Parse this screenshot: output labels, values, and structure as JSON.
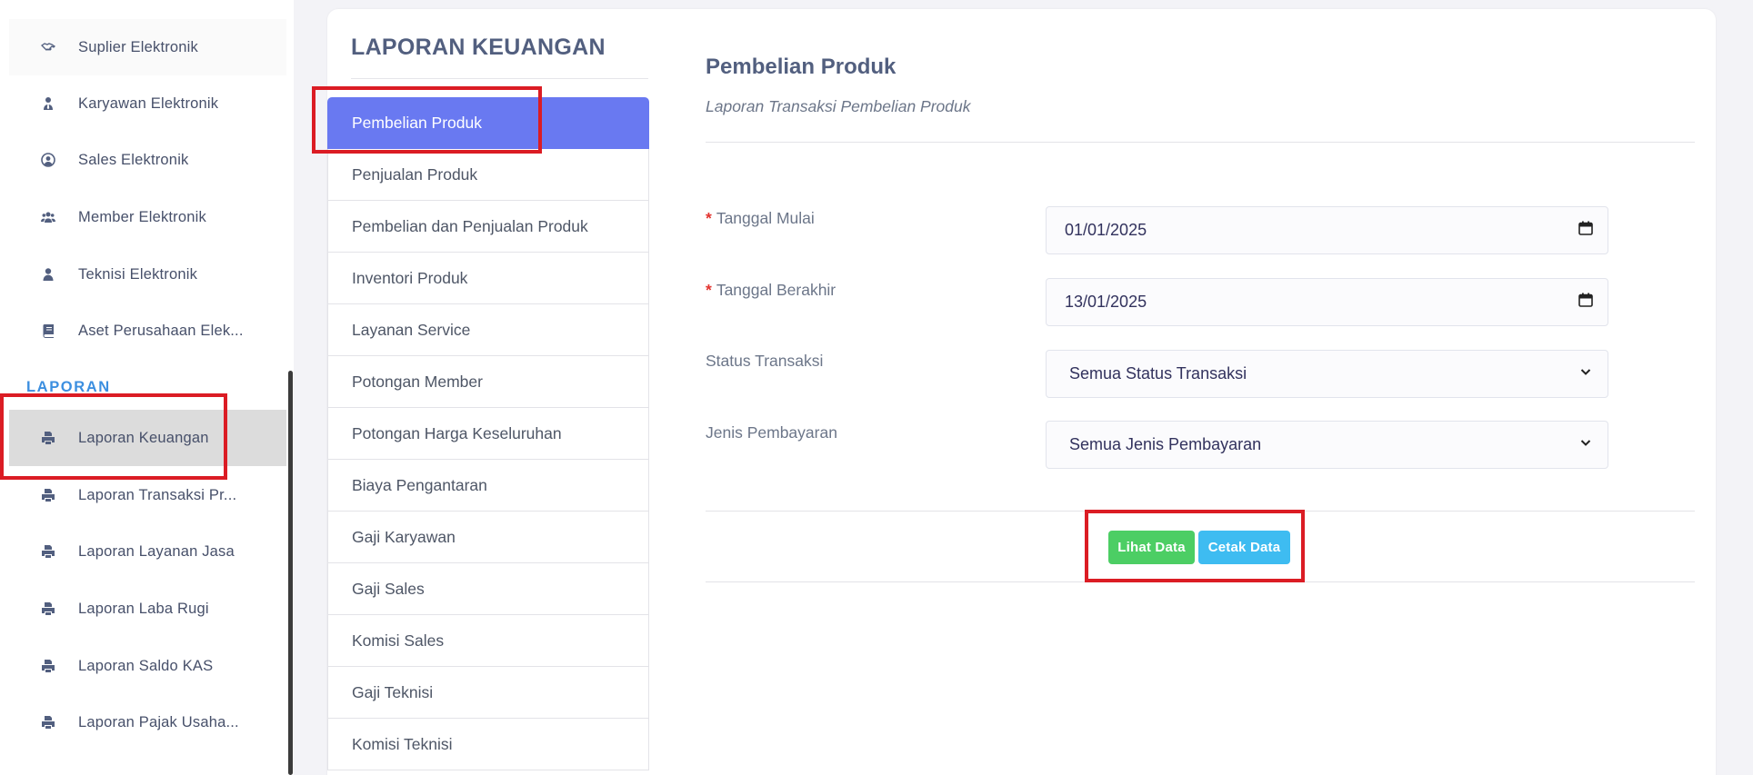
{
  "sidebar": {
    "items_top": [
      {
        "label": "Suplier Elektronik",
        "icon": "handshake-icon"
      },
      {
        "label": "Karyawan Elektronik",
        "icon": "user-tie-icon"
      },
      {
        "label": "Sales Elektronik",
        "icon": "user-circle-icon"
      },
      {
        "label": "Member Elektronik",
        "icon": "users-icon"
      },
      {
        "label": "Teknisi Elektronik",
        "icon": "user-icon"
      },
      {
        "label": "Aset Perusahaan Elek...",
        "icon": "book-icon"
      }
    ],
    "section_heading": "LAPORAN",
    "items_laporan": [
      {
        "label": "Laporan Keuangan",
        "icon": "print-icon",
        "active": true
      },
      {
        "label": "Laporan Transaksi Pr...",
        "icon": "print-icon"
      },
      {
        "label": "Laporan Layanan Jasa",
        "icon": "print-icon"
      },
      {
        "label": "Laporan Laba Rugi",
        "icon": "print-icon"
      },
      {
        "label": "Laporan Saldo KAS",
        "icon": "print-icon"
      },
      {
        "label": "Laporan Pajak Usaha...",
        "icon": "print-icon"
      }
    ]
  },
  "report_menu": {
    "title": "LAPORAN KEUANGAN",
    "items": [
      "Pembelian Produk",
      "Penjualan Produk",
      "Pembelian dan Penjualan Produk",
      "Inventori Produk",
      "Layanan Service",
      "Potongan Member",
      "Potongan Harga Keseluruhan",
      "Biaya Pengantaran",
      "Gaji Karyawan",
      "Gaji Sales",
      "Komisi Sales",
      "Gaji Teknisi",
      "Komisi Teknisi"
    ],
    "active_index": 0
  },
  "form": {
    "title": "Pembelian Produk",
    "subtitle": "Laporan Transaksi Pembelian Produk",
    "required_mark": "*",
    "fields": {
      "start_date": {
        "label": "Tanggal Mulai",
        "value": "01/01/2025"
      },
      "end_date": {
        "label": "Tanggal Berakhir",
        "value": "13/01/2025"
      },
      "status": {
        "label": "Status Transaksi",
        "value": "Semua Status Transaksi"
      },
      "payment": {
        "label": "Jenis Pembayaran",
        "value": "Semua Jenis Pembayaran"
      }
    },
    "buttons": {
      "view_label": "Lihat Data",
      "print_label": "Cetak Data"
    }
  },
  "colors": {
    "accent": "#6979f1",
    "view_button": "#4cce64",
    "print_button": "#3ebcf1",
    "annotation": "#db1c24",
    "section_heading": "#3c8fe0"
  }
}
